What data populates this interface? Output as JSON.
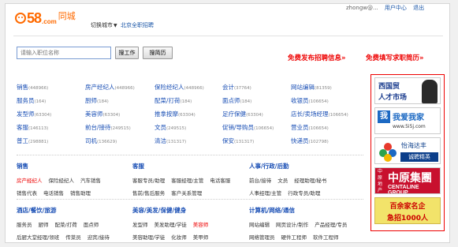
{
  "header": {
    "logo_mark": "58",
    "logo_dotcom": ".com",
    "logo_cn": "同城",
    "city_switch": "切换城市",
    "city_name": "北京全职招聘",
    "user_email": "zhongw@... ",
    "user_center": "用户中心",
    "logout": "退出"
  },
  "search": {
    "placeholder": "请输入职位名称",
    "find_job": "搜工作",
    "find_resume": "搜简历"
  },
  "promos": {
    "post_job": "免费发布招聘信息»",
    "write_resume": "免费填写求职简历»"
  },
  "hot_jobs": [
    {
      "title": "销售",
      "count": "(448966)"
    },
    {
      "title": "房产经纪人",
      "count": "(448966)"
    },
    {
      "title": "保险经纪人",
      "count": "(448966)"
    },
    {
      "title": "会计",
      "count": "(37764)"
    },
    {
      "title": "网站编辑",
      "count": "(81359)"
    },
    {
      "title": "服务员",
      "count": "(164)"
    },
    {
      "title": "厨师",
      "count": "(184)"
    },
    {
      "title": "配菜/打荷",
      "count": "(184)"
    },
    {
      "title": "面点师",
      "count": "(184)"
    },
    {
      "title": "收银员",
      "count": "(106654)"
    },
    {
      "title": "发型师",
      "count": "(63304)"
    },
    {
      "title": "美容师",
      "count": "(63304)"
    },
    {
      "title": "推拿按摩",
      "count": "(63304)"
    },
    {
      "title": "足疗保健",
      "count": "(63304)"
    },
    {
      "title": "店长/卖场经理",
      "count": "(106654)"
    },
    {
      "title": "客服",
      "count": "(146113)"
    },
    {
      "title": "前台/接待",
      "count": "(249515)"
    },
    {
      "title": "文员",
      "count": "(249515)"
    },
    {
      "title": "促销/导购员",
      "count": "(106654)"
    },
    {
      "title": "营业员",
      "count": "(106654)"
    },
    {
      "title": "普工",
      "count": "(298881)"
    },
    {
      "title": "司机",
      "count": "(136629)"
    },
    {
      "title": "清洁",
      "count": "(131317)"
    },
    {
      "title": "保安",
      "count": "(131317)"
    },
    {
      "title": "快递员",
      "count": "(102798)"
    }
  ],
  "categories": [
    {
      "title": "销售",
      "rows": [
        [
          "房产经纪人",
          "保险经纪人",
          "汽车销售"
        ],
        [
          "销售代表",
          "电话销售",
          "销售助理"
        ]
      ],
      "red": "房产经纪人"
    },
    {
      "title": "客服",
      "rows": [
        [
          "客服专员/助理",
          "客服经理/主管",
          "电话客服"
        ],
        [
          "售前/售后服务",
          "客户关系管理"
        ]
      ],
      "red": ""
    },
    {
      "title": "人事/行政/后勤",
      "rows": [
        [
          "前台/接待",
          "文员",
          "经理助理/秘书"
        ],
        [
          "人事经理/主管",
          "行政专员/助理"
        ]
      ],
      "red": ""
    },
    {
      "title": "酒店/餐饮/旅游",
      "rows": [
        [
          "服务员",
          "厨师",
          "配菜/打荷",
          "面点师"
        ],
        [
          "后厨大堂经理/领班",
          "传菜员",
          "迎宾/接待"
        ]
      ],
      "red": ""
    },
    {
      "title": "美容/美发/保健/健身",
      "rows": [
        [
          "发型师",
          "美发助理/学徒",
          "美容师"
        ],
        [
          "美容助理/学徒",
          "化妆师",
          "美甲师"
        ]
      ],
      "red": "美容师"
    },
    {
      "title": "计算机/网络/通信",
      "rows": [
        [
          "网站编辑",
          "网页设计/制作",
          "产品经理/专员"
        ],
        [
          "网络管理员",
          "硬件工程师",
          "软件工程师"
        ]
      ],
      "red": ""
    }
  ],
  "ads": {
    "ad1_line1": "西国贸",
    "ad1_line2": "人才市场",
    "ad2_box": "我",
    "ad2_line1": "我爱我家",
    "ad2_line2": "www.5i5j.com",
    "ad3_line1": "怡海达丰",
    "ad3_line2": "诚聘精英",
    "ad4_side": "中原地产",
    "ad4_line1": "中原集團",
    "ad4_line2": "CENTALINE GROUP",
    "ad5_line1": "百余家名企",
    "ad5_line2": "急招1000人"
  },
  "colors": {
    "brand": "#ff6a00",
    "link": "#1a4fb5",
    "promo": "#ee0000"
  }
}
